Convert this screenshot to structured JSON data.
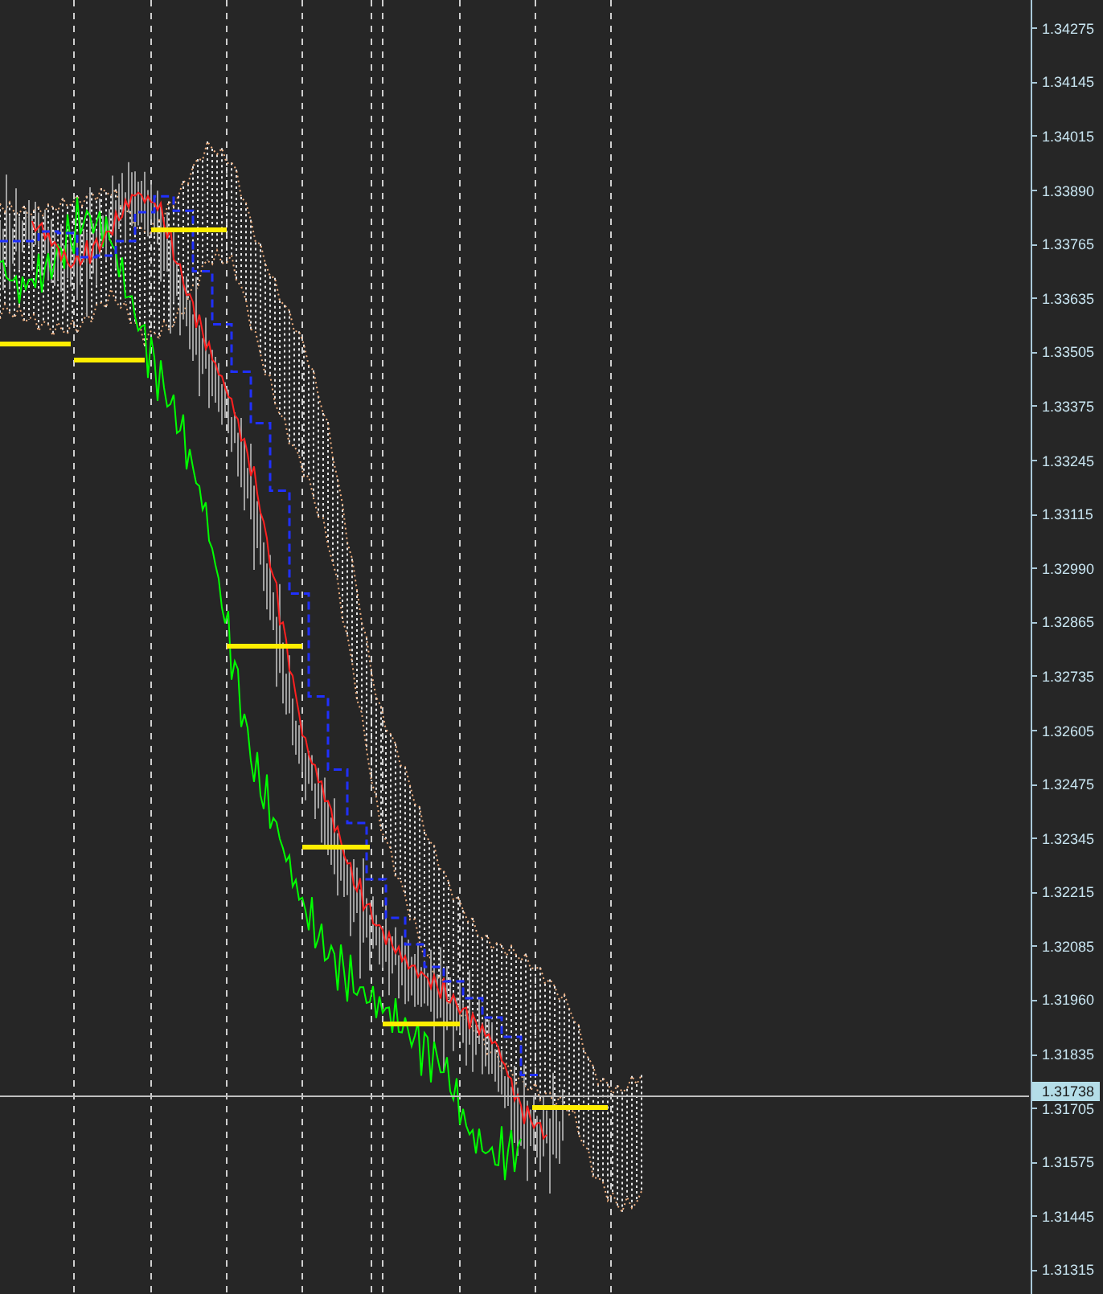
{
  "price_axis": {
    "labels": [
      "1.34275",
      "1.34145",
      "1.34015",
      "1.33890",
      "1.33765",
      "1.33635",
      "1.33505",
      "1.33375",
      "1.33245",
      "1.33115",
      "1.32990",
      "1.32865",
      "1.32735",
      "1.32605",
      "1.32475",
      "1.32345",
      "1.32215",
      "1.32085",
      "1.31960",
      "1.31835",
      "1.31705",
      "1.31575",
      "1.31445",
      "1.31315"
    ]
  },
  "current_price": {
    "label": "1.31738"
  }
}
